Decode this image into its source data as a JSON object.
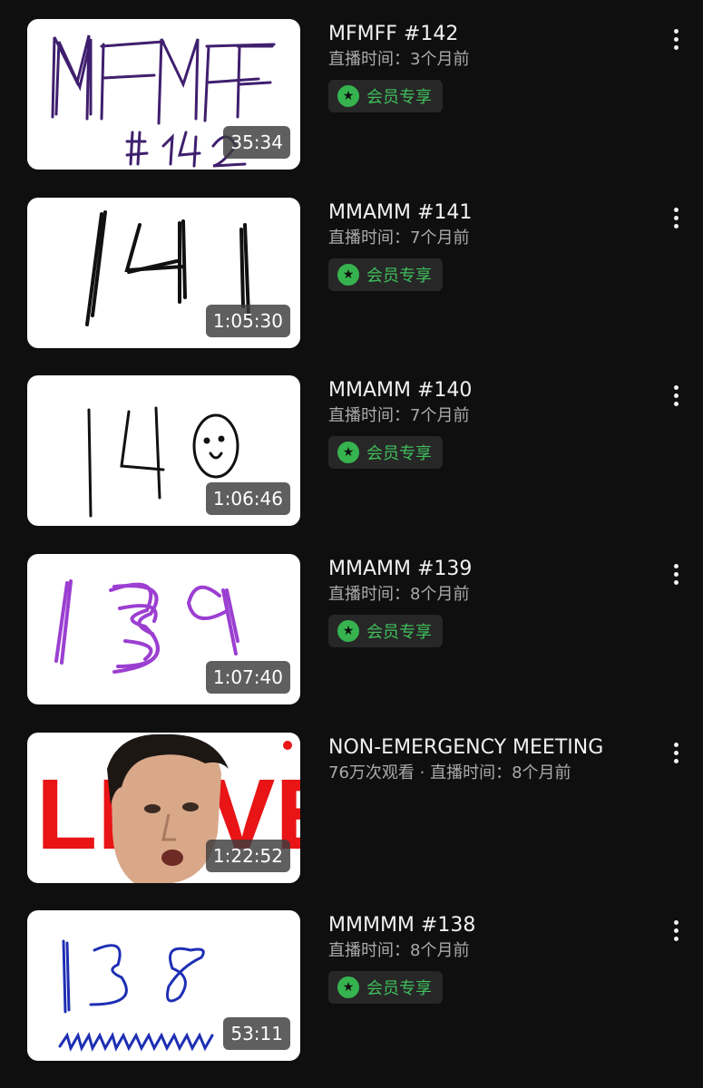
{
  "videos": [
    {
      "title": "MFMFF #142",
      "meta": "直播时间：3个月前",
      "duration": "35:34",
      "badge": "会员专享"
    },
    {
      "title": "MMAMM #141",
      "meta": "直播时间：7个月前",
      "duration": "1:05:30",
      "badge": "会员专享"
    },
    {
      "title": "MMAMM #140",
      "meta": "直播时间：7个月前",
      "duration": "1:06:46",
      "badge": "会员专享"
    },
    {
      "title": "MMAMM #139",
      "meta": "直播时间：8个月前",
      "duration": "1:07:40",
      "badge": "会员专享"
    },
    {
      "title": "NON-EMERGENCY MEETING",
      "meta": "76万次观看 · 直播时间：8个月前",
      "duration": "1:22:52",
      "thumb_text": "LIVE"
    },
    {
      "title": "MMMMM #138",
      "meta": "直播时间：8个月前",
      "duration": "53:11",
      "badge": "会员专享"
    }
  ],
  "colors": {
    "background": "#0f0f0f",
    "badge_green": "#3fbf5b",
    "live_red": "#e81416"
  },
  "icons": {
    "member_badge": "star-circle-icon",
    "menu": "more-vertical-icon"
  }
}
